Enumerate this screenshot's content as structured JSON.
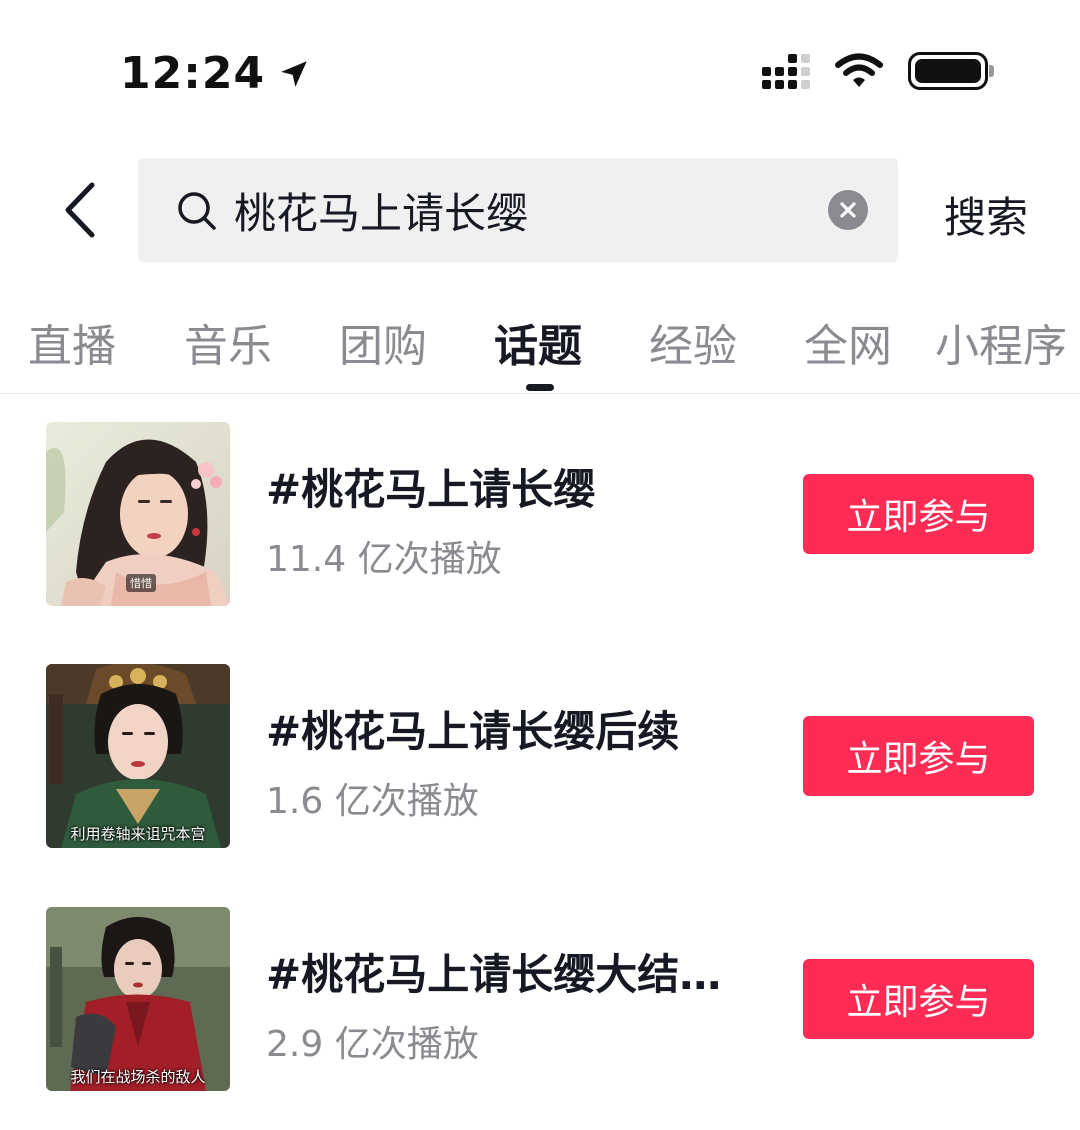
{
  "status_bar": {
    "time": "12:24",
    "icons": [
      "location-arrow-icon",
      "cellular-signal-icon",
      "wifi-icon",
      "battery-icon"
    ]
  },
  "search": {
    "back_icon": "chevron-left-icon",
    "icon": "search-icon",
    "value": "桃花马上请长缨",
    "clear_icon": "clear-icon",
    "submit_label": "搜索"
  },
  "tabs": [
    {
      "label": "直播",
      "active": false
    },
    {
      "label": "音乐",
      "active": false
    },
    {
      "label": "团购",
      "active": false
    },
    {
      "label": "话题",
      "active": true
    },
    {
      "label": "经验",
      "active": false
    },
    {
      "label": "全网",
      "active": false
    },
    {
      "label": "小程序",
      "active": false
    }
  ],
  "results": [
    {
      "title": "#桃花马上请长缨",
      "views": "11.4 亿次播放",
      "button": "立即参与",
      "thumb_caption": "惜惜"
    },
    {
      "title": "#桃花马上请长缨后续",
      "views": "1.6 亿次播放",
      "button": "立即参与",
      "thumb_caption": "利用卷轴来诅咒本宫"
    },
    {
      "title": "#桃花马上请长缨大结…",
      "views": "2.9 亿次播放",
      "button": "立即参与",
      "thumb_caption": "我们在战场杀的敌人"
    }
  ],
  "colors": {
    "accent": "#fe2c55",
    "text_primary": "#161823",
    "text_secondary": "#8a8b91",
    "search_bg": "#f0f0f1"
  }
}
